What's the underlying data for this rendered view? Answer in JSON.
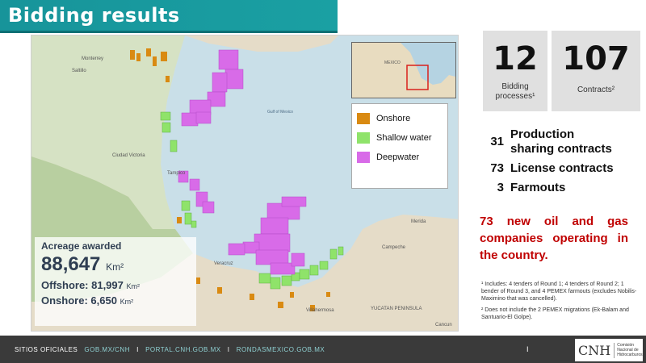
{
  "header": {
    "title": "Bidding results"
  },
  "map": {
    "legend": [
      {
        "label": "Onshore",
        "color": "#d98a12"
      },
      {
        "label": "Shallow water",
        "color": "#8fe36a"
      },
      {
        "label": "Deepwater",
        "color": "#d86be8"
      }
    ],
    "inset_label": "MEXICO",
    "labels": [
      "Monterrey",
      "Saltillo",
      "Ciudad Victoria",
      "Tampico",
      "Gulf of Mexico",
      "Veracruz",
      "Villahermosa",
      "Campeche",
      "Merida",
      "YUCATAN PENINSULA",
      "Cancun"
    ],
    "acreage": {
      "title": "Acreage awarded",
      "total_value": "88,647",
      "total_unit": "Km²",
      "offshore_label": "Offshore: 81,997",
      "offshore_unit": "Km²",
      "onshore_label": "Onshore: 6,650",
      "onshore_unit": "Km²"
    }
  },
  "stats": {
    "bidding": {
      "value": "12",
      "label_line1": "Bidding",
      "label_line2": "processes¹"
    },
    "contracts": {
      "value": "107",
      "label": "Contracts²"
    }
  },
  "contract_types": [
    {
      "count": "31",
      "label": "Production sharing contracts"
    },
    {
      "count": "73",
      "label": "License contracts"
    },
    {
      "count": "3",
      "label": "Farmouts"
    }
  ],
  "highlight": "73 new oil and gas companies operating in the country.",
  "footnotes": {
    "first": "¹ Includes: 4 tenders of Round 1; 4 tenders of Round 2; 1 bender of Round 3, and 4 PEMEX farmouts (excludes Nobilis-Maximino that was cancelled).",
    "second": "² Does not include the 2 PEMEX migrations (Ek-Balam and Santuario-El Golpe)."
  },
  "footer": {
    "prefix": "SITIOS OFICIALES",
    "link1": "GOB.MX/CNH",
    "link2": "PORTAL.CNH.GOB.MX",
    "link3": "RONDASMEXICO.GOB.MX",
    "separator": "I",
    "logo_mark": "CNH",
    "logo_sub": "Comisión Nacional de Hidrocarburos"
  }
}
